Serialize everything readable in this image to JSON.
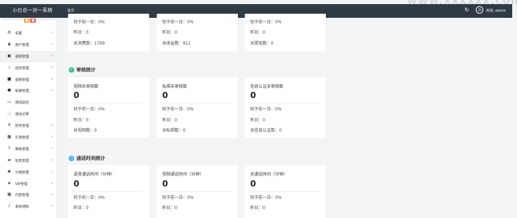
{
  "header": {
    "title": "小白合一对一系统",
    "home_tab": "首页",
    "user": "欢迎, admin",
    "watermark": "www.xxxxxx.com"
  },
  "sidebar": {
    "items": [
      {
        "label": "设置",
        "icon": "gear-icon"
      },
      {
        "label": "用户管理",
        "icon": "users-icon"
      },
      {
        "label": "视频管理",
        "icon": "video-icon"
      },
      {
        "label": "动态管理",
        "icon": "star-icon"
      },
      {
        "label": "视频管理",
        "icon": "camera-icon"
      },
      {
        "label": "私聊管理",
        "icon": "chat-icon"
      },
      {
        "label": "通话监控",
        "icon": "monitor-icon"
      },
      {
        "label": "通话记录",
        "icon": "call-log-icon"
      },
      {
        "label": "财务管理",
        "icon": "finance-icon"
      },
      {
        "label": "礼物管理",
        "icon": "gift-icon"
      },
      {
        "label": "等级管理",
        "icon": "level-icon"
      },
      {
        "label": "标签管理",
        "icon": "tag-icon"
      },
      {
        "label": "分销管理",
        "icon": "share-icon"
      },
      {
        "label": "VIP管理",
        "icon": "vip-icon"
      },
      {
        "label": "内容管理",
        "icon": "grid-icon"
      },
      {
        "label": "系统通知",
        "icon": "bell-icon"
      }
    ]
  },
  "top_cards": [
    {
      "compare": "较于前一日：0%",
      "yesterday": "昨日：0",
      "total": "总消费数：1799"
    },
    {
      "compare": "较于前一日：0%",
      "yesterday": "昨日：0",
      "total": "总收益数：811"
    },
    {
      "compare": "较于前一日：0%",
      "yesterday": "昨日：0",
      "total": "总提现数：0"
    }
  ],
  "audit": {
    "title": "审核统计",
    "cards": [
      {
        "title": "视频未审核数",
        "value": "0",
        "compare": "较于前一日：0%",
        "yesterday": "昨日：0",
        "total": "总视频数：0"
      },
      {
        "title": "私照未审核数",
        "value": "0",
        "compare": "较于前一日：0%",
        "yesterday": "昨日：0",
        "total": "总私照数：0"
      },
      {
        "title": "信息认证未审核数",
        "value": "0",
        "compare": "较于前一日：0%",
        "yesterday": "昨日：0",
        "total": "总信息认证数：0"
      }
    ]
  },
  "calls": {
    "title": "通话时间统计",
    "cards": [
      {
        "title": "语音通话时间（分钟）",
        "value": "0",
        "compare": "较于前一日：0%",
        "yesterday": "昨日：0"
      },
      {
        "title": "视频通话时间（分钟）",
        "value": "0",
        "compare": "较于前一日：0%",
        "yesterday": "昨日：0"
      },
      {
        "title": "总通话时间（分钟）",
        "value": "0",
        "compare": "较于前一日：0%",
        "yesterday": "昨日：0"
      }
    ]
  },
  "colors": {
    "topbar": "#2f3a44",
    "audit_icon": "#36c28c",
    "call_icon": "#38a8e8"
  }
}
